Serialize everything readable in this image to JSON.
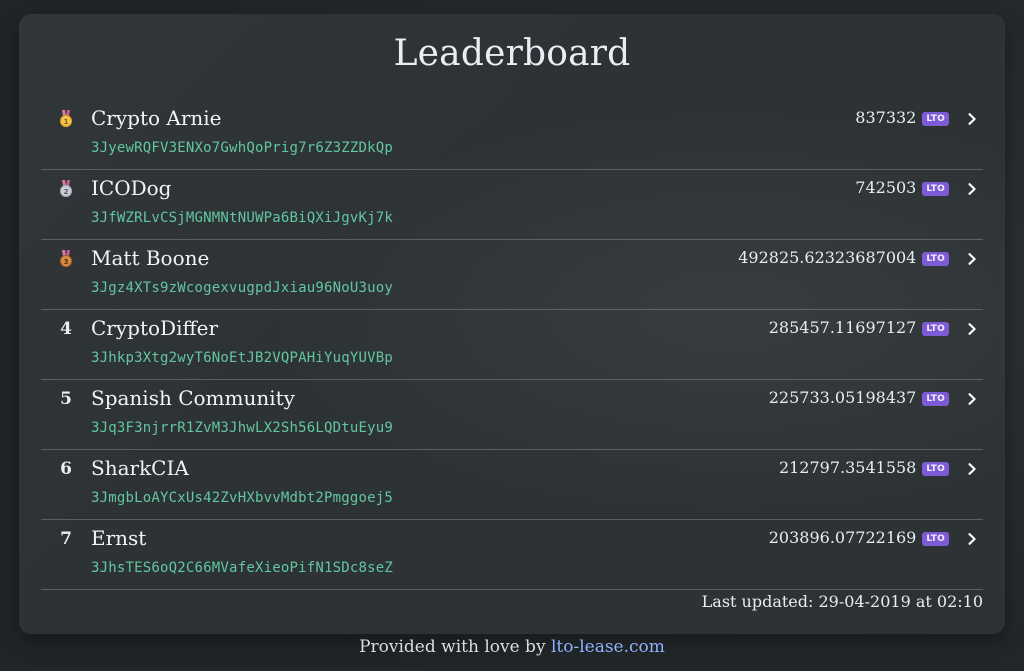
{
  "title": "Leaderboard",
  "badge_label": "LTO",
  "colors": {
    "background": "#202527",
    "card": "#2D3235",
    "text": "#F0F4F8",
    "address": "#62C6A1",
    "badge_bg": "#7D5AD6",
    "link": "#8FB3FF"
  },
  "rows": [
    {
      "rank": "1",
      "rank_display": "medal-gold",
      "name": "Crypto Arnie",
      "address": "3JyewRQFV3ENXo7GwhQoPrig7r6Z3ZZDkQp",
      "amount": "837332"
    },
    {
      "rank": "2",
      "rank_display": "medal-silver",
      "name": "ICODog",
      "address": "3JfWZRLvCSjMGNMNtNUWPa6BiQXiJgvKj7k",
      "amount": "742503"
    },
    {
      "rank": "3",
      "rank_display": "medal-bronze",
      "name": "Matt Boone",
      "address": "3Jgz4XTs9zWcogexvugpdJxiau96NoU3uoy",
      "amount": "492825.62323687004"
    },
    {
      "rank": "4",
      "rank_display": "text",
      "name": "CryptoDiffer",
      "address": "3Jhkp3Xtg2wyT6NoEtJB2VQPAHiYuqYUVBp",
      "amount": "285457.11697127"
    },
    {
      "rank": "5",
      "rank_display": "text",
      "name": "Spanish Community",
      "address": "3Jq3F3njrrR1ZvM3JhwLX2Sh56LQDtuEyu9",
      "amount": "225733.05198437"
    },
    {
      "rank": "6",
      "rank_display": "text",
      "name": "SharkCIA",
      "address": "3JmgbLoAYCxUs42ZvHXbvvMdbt2Pmggoej5",
      "amount": "212797.3541558"
    },
    {
      "rank": "7",
      "rank_display": "text",
      "name": "Ernst",
      "address": "3JhsTES6oQ2C66MVafeXieoPifN1SDc8seZ",
      "amount": "203896.07722169"
    }
  ],
  "last_updated": "Last updated: 29-04-2019 at 02:10",
  "provided": {
    "prefix": "Provided with love by ",
    "link_text": "lto-lease.com"
  }
}
